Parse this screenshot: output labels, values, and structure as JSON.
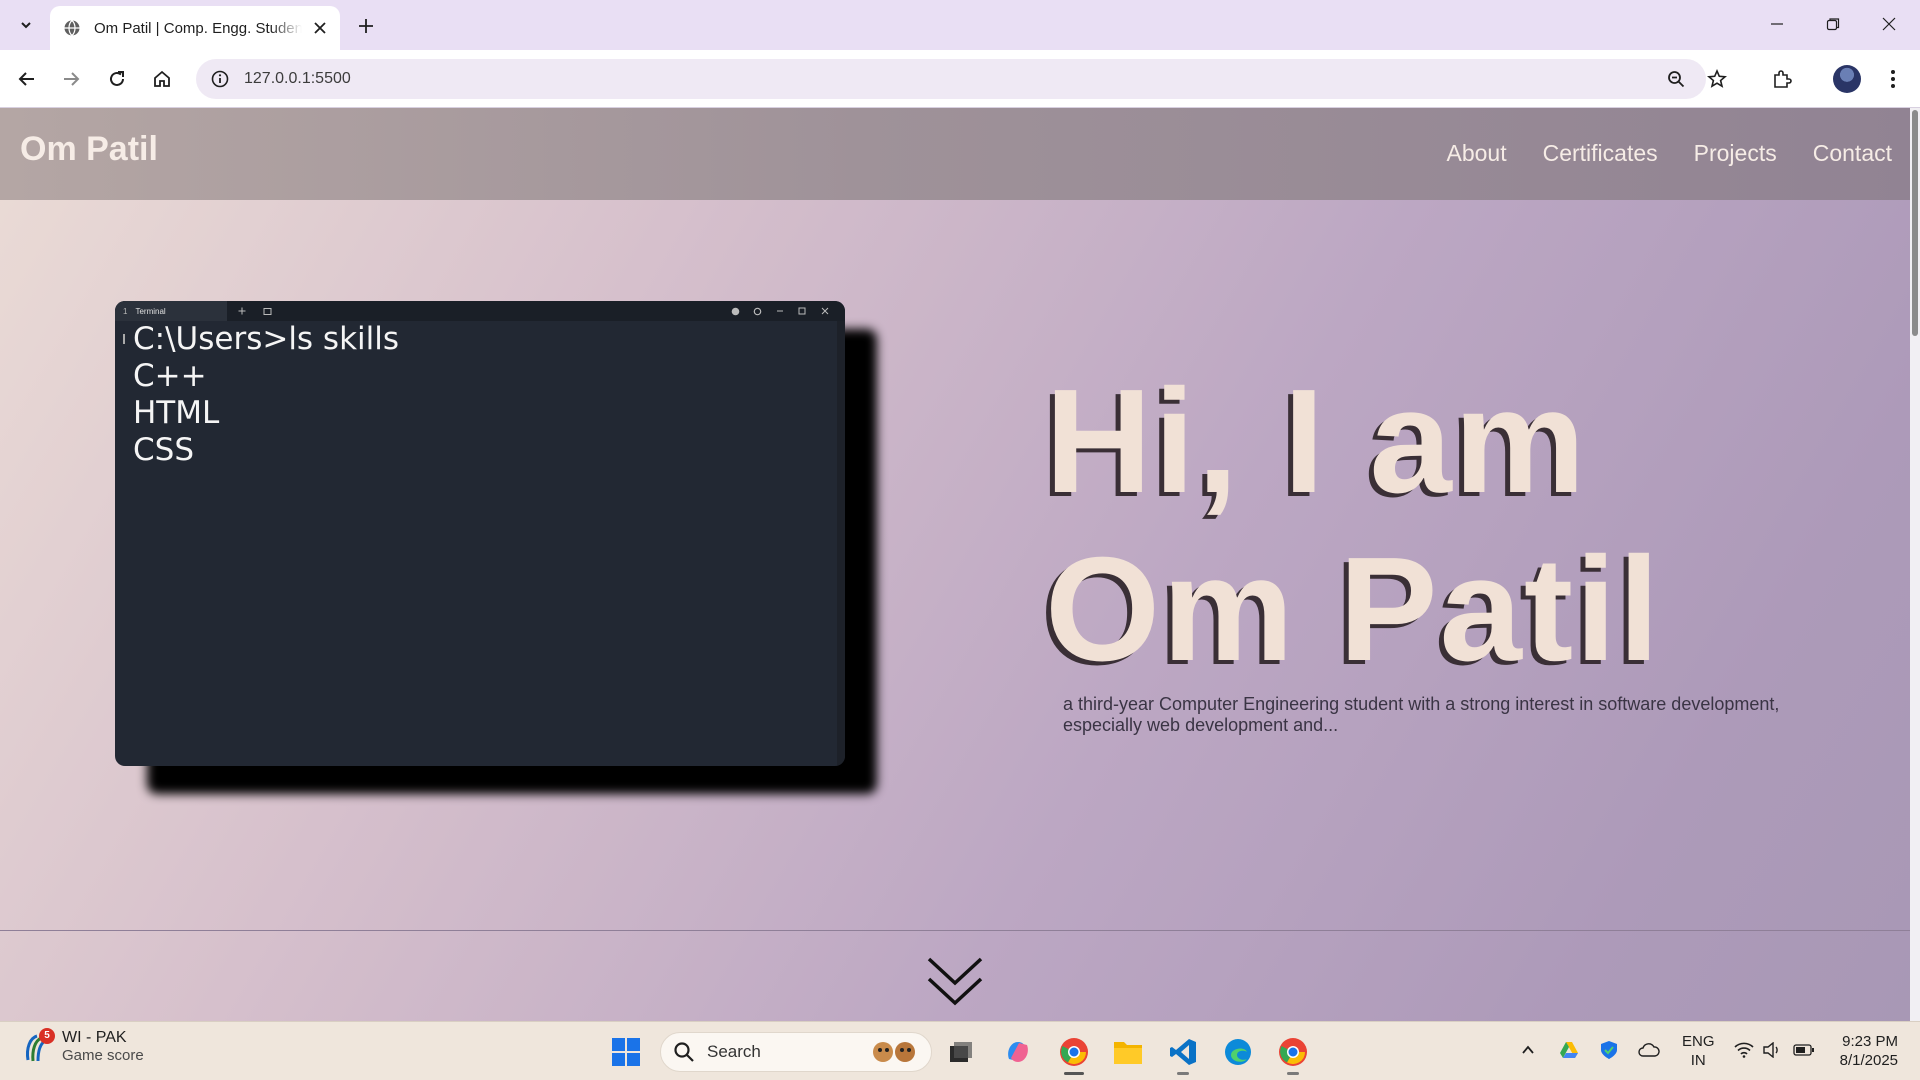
{
  "browser": {
    "tab_title": "Om Patil | Comp. Engg. Student",
    "url": "127.0.0.1:5500",
    "icons": [
      "tab-search-icon",
      "globe-icon",
      "close-icon",
      "plus-icon",
      "minimize-icon",
      "restore-icon",
      "close-window-icon",
      "back-icon",
      "forward-icon",
      "reload-icon",
      "home-icon",
      "info-icon",
      "zoom-icon",
      "star-icon",
      "extensions-icon",
      "avatar",
      "more-icon"
    ]
  },
  "site": {
    "brand": "Om Patil",
    "nav": [
      "About",
      "Certificates",
      "Projects",
      "Contact"
    ],
    "terminal": {
      "tab_number": "1",
      "tab_label": "Terminal",
      "lines": [
        "C:\\Users>ls skills",
        "C++",
        "HTML",
        "CSS"
      ]
    },
    "hero": {
      "greeting": "Hi, I am",
      "name": "Om Patil",
      "description": "a third-year Computer Engineering student with a strong interest in software development, especially web development and..."
    },
    "scroll_icon": "chevron-down-double-icon"
  },
  "taskbar": {
    "weather_badge": "5",
    "weather_title": "WI - PAK",
    "weather_subtitle": "Game score",
    "search_placeholder": "Search",
    "lang_line1": "ENG",
    "lang_line2": "IN",
    "time": "9:23 PM",
    "date": "8/1/2025"
  },
  "colors": {
    "accent_text": "#f1e1d6",
    "terminal_bg": "#222833",
    "nav_bg": "#9f9299"
  }
}
